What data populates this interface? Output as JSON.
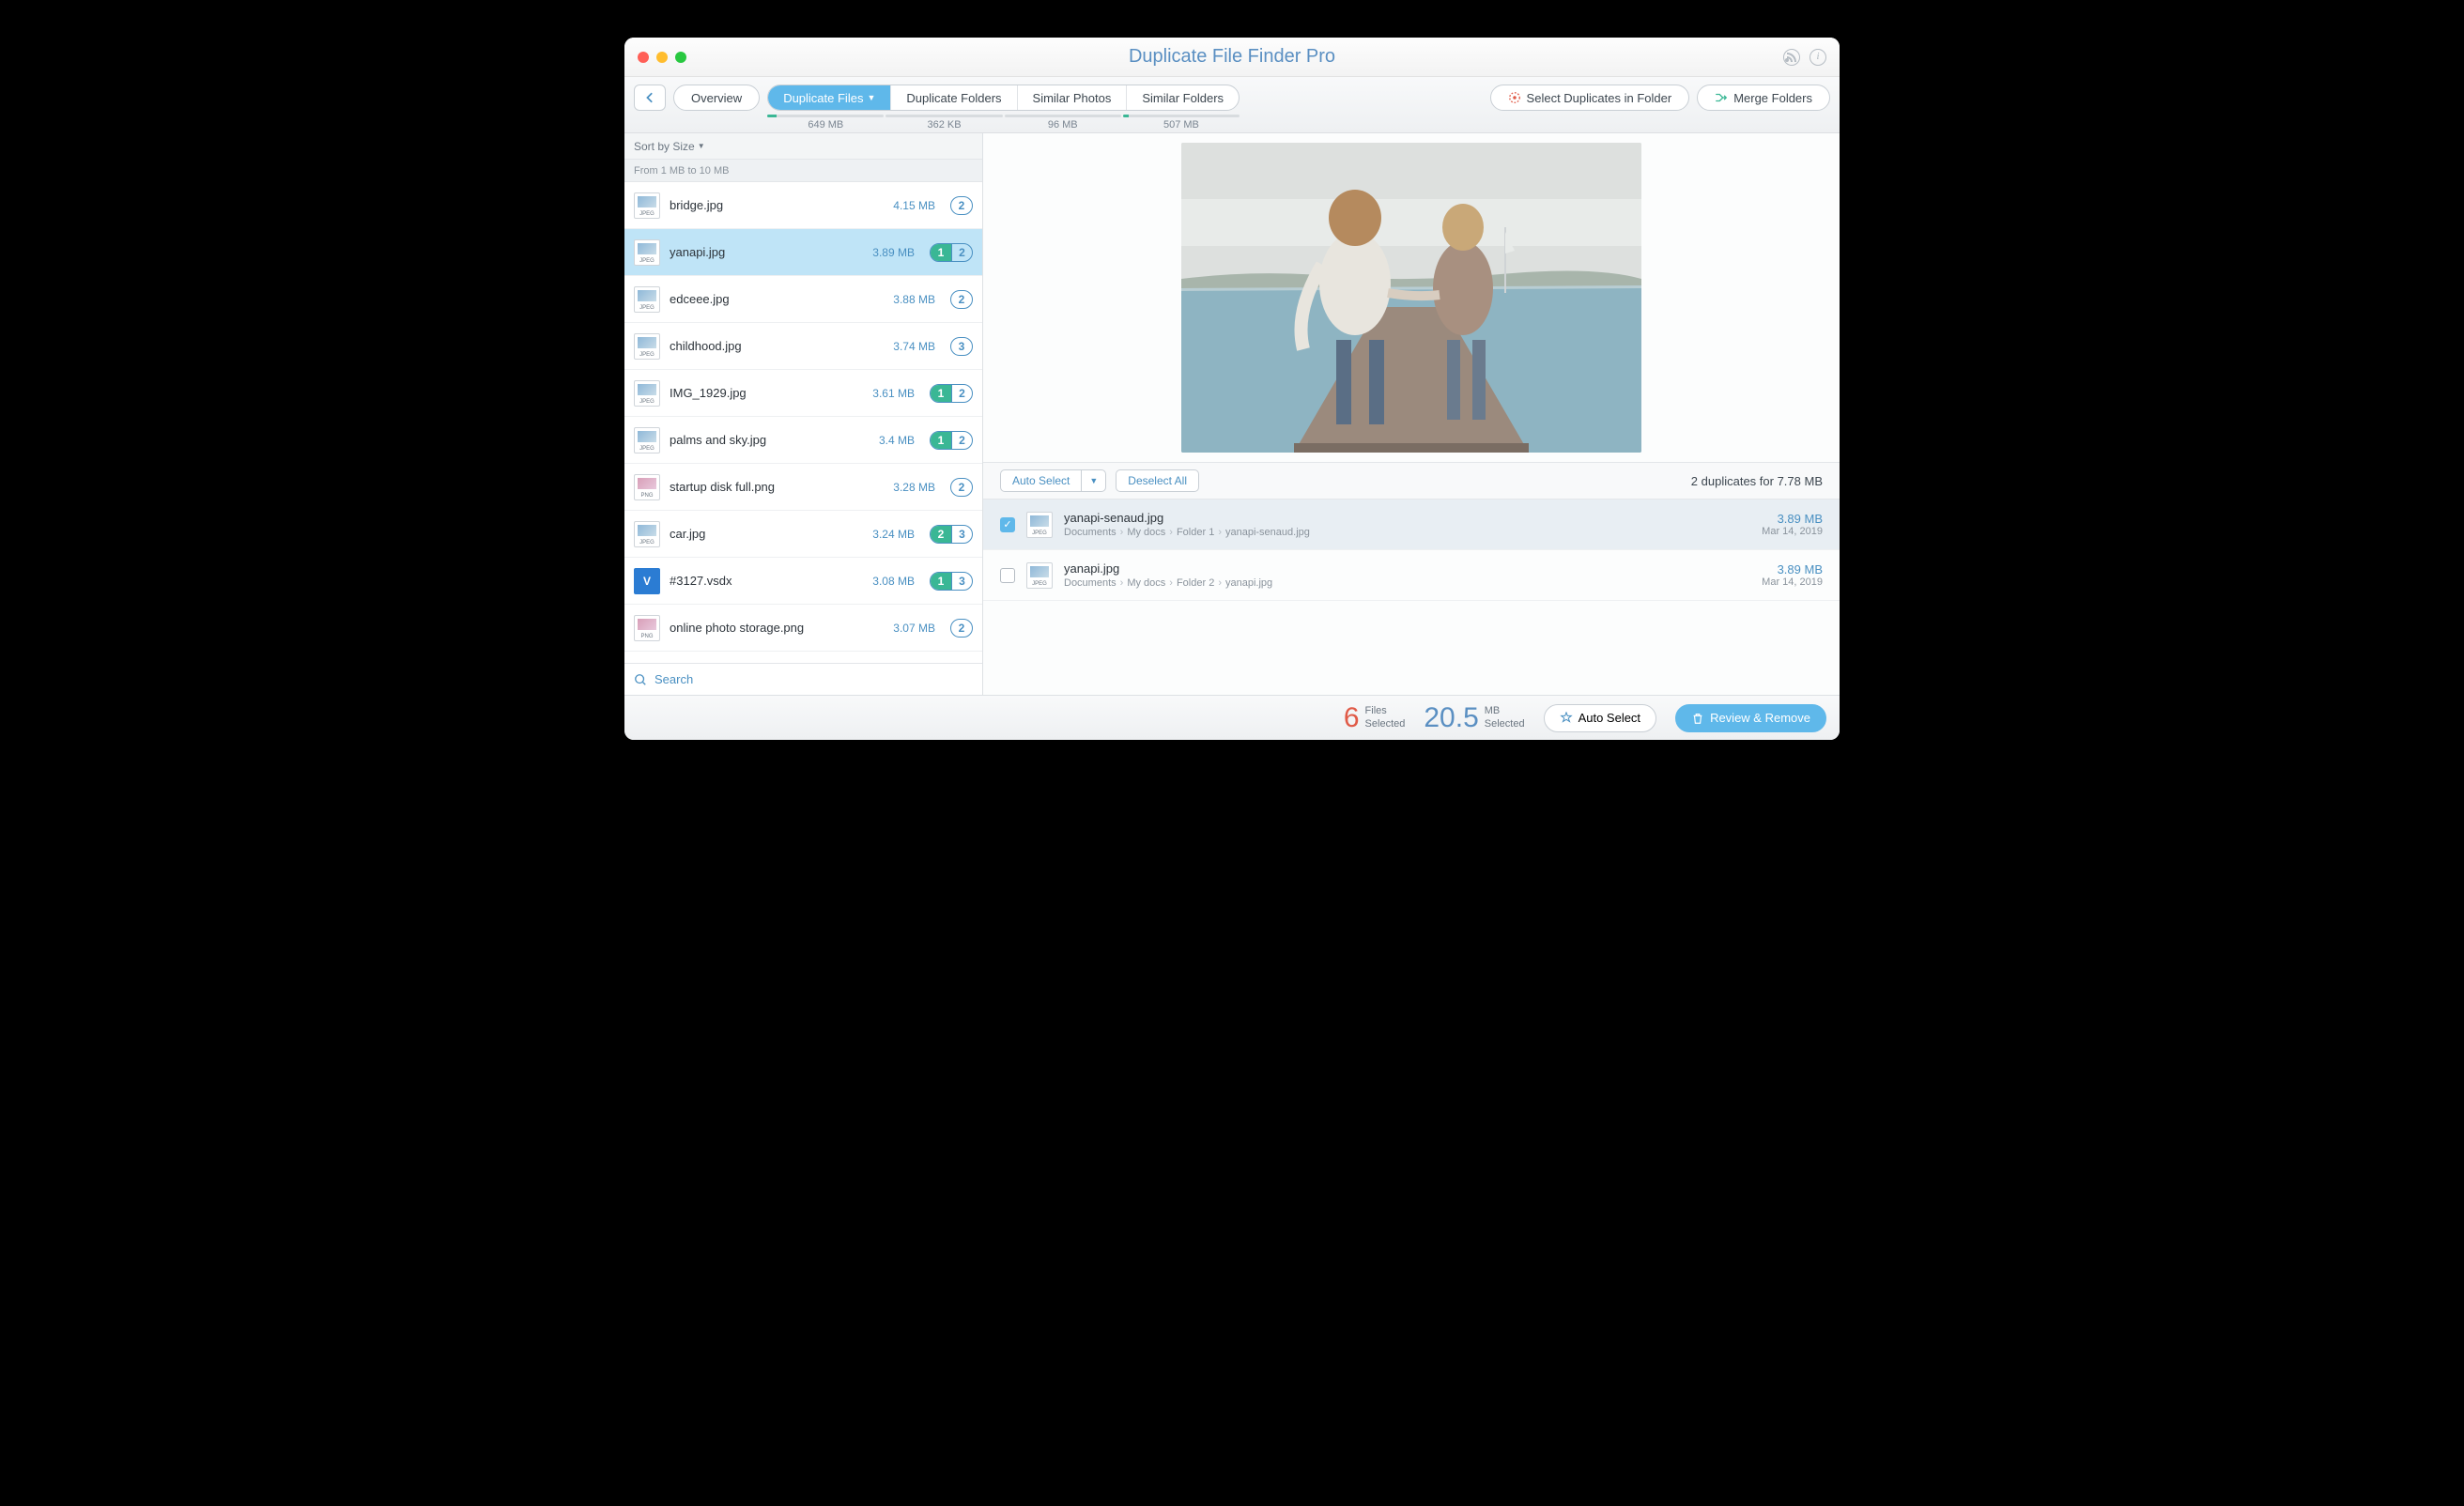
{
  "title": "Duplicate File Finder Pro",
  "toolbar": {
    "overview": "Overview",
    "tabs": [
      {
        "label": "Duplicate Files",
        "size": "649 MB",
        "progress": 8
      },
      {
        "label": "Duplicate Folders",
        "size": "362 KB",
        "progress": 0
      },
      {
        "label": "Similar Photos",
        "size": "96 MB",
        "progress": 0
      },
      {
        "label": "Similar Folders",
        "size": "507 MB",
        "progress": 5
      }
    ],
    "select_in_folder": "Select Duplicates in Folder",
    "merge_folders": "Merge Folders"
  },
  "sidebar": {
    "sort_label": "Sort by Size",
    "range_label": "From 1 MB to 10 MB",
    "search_placeholder": "Search",
    "files": [
      {
        "name": "bridge.jpg",
        "size": "4.15 MB",
        "ext": "JPEG",
        "badge": [
          2
        ]
      },
      {
        "name": "yanapi.jpg",
        "size": "3.89 MB",
        "ext": "JPEG",
        "badge": [
          1,
          2
        ],
        "selected": true,
        "on": [
          0
        ]
      },
      {
        "name": "edceee.jpg",
        "size": "3.88 MB",
        "ext": "JPEG",
        "badge": [
          2
        ]
      },
      {
        "name": "childhood.jpg",
        "size": "3.74 MB",
        "ext": "JPEG",
        "badge": [
          3
        ]
      },
      {
        "name": "IMG_1929.jpg",
        "size": "3.61 MB",
        "ext": "JPEG",
        "badge": [
          1,
          2
        ],
        "on": [
          0
        ]
      },
      {
        "name": "palms and sky.jpg",
        "size": "3.4 MB",
        "ext": "JPEG",
        "badge": [
          1,
          2
        ],
        "on": [
          0
        ]
      },
      {
        "name": "startup disk full.png",
        "size": "3.28 MB",
        "ext": "PNG",
        "badge": [
          2
        ]
      },
      {
        "name": "car.jpg",
        "size": "3.24 MB",
        "ext": "JPEG",
        "badge": [
          2,
          3
        ],
        "on": [
          0
        ]
      },
      {
        "name": "#3127.vsdx",
        "size": "3.08 MB",
        "ext": "V",
        "badge": [
          1,
          3
        ],
        "on": [
          0
        ]
      },
      {
        "name": "online photo storage.png",
        "size": "3.07 MB",
        "ext": "PNG",
        "badge": [
          2
        ]
      }
    ]
  },
  "detail": {
    "auto_select": "Auto Select",
    "deselect_all": "Deselect All",
    "summary": "2 duplicates for 7.78 MB",
    "items": [
      {
        "name": "yanapi-senaud.jpg",
        "path": [
          "Documents",
          "My docs",
          "Folder 1",
          "yanapi-senaud.jpg"
        ],
        "size": "3.89 MB",
        "date": "Mar 14, 2019",
        "checked": true
      },
      {
        "name": "yanapi.jpg",
        "path": [
          "Documents",
          "My docs",
          "Folder 2",
          "yanapi.jpg"
        ],
        "size": "3.89 MB",
        "date": "Mar 14, 2019",
        "checked": false
      }
    ]
  },
  "footer": {
    "files_count": "6",
    "files_label1": "Files",
    "files_label2": "Selected",
    "mb_count": "20.5",
    "mb_label1": "MB",
    "mb_label2": "Selected",
    "auto_select": "Auto Select",
    "review_remove": "Review & Remove"
  }
}
